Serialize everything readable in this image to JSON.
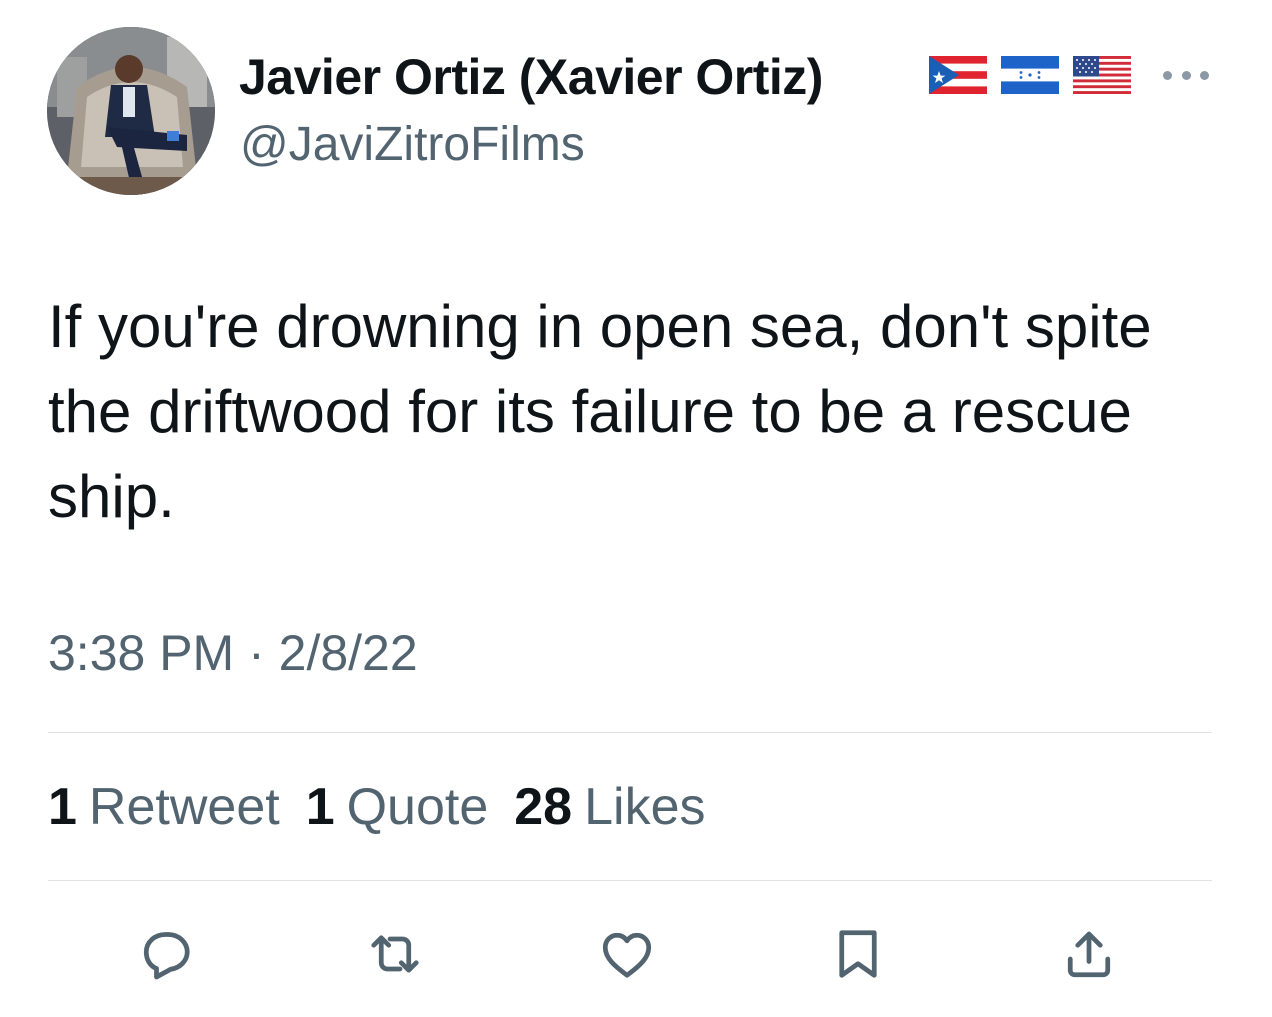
{
  "author": {
    "display_name": "Javier Ortiz (Xavier Ortiz)",
    "handle": "@JaviZitroFilms",
    "flags": [
      "puerto-rico-flag",
      "honduras-flag",
      "united-states-flag"
    ]
  },
  "tweet": {
    "text": "If you're drowning in open sea, don't spite the driftwood for its failure to be a rescue ship.",
    "timestamp": "3:38 PM · 2/8/22"
  },
  "stats": {
    "retweets_count": "1",
    "retweets_label": "Retweet",
    "quotes_count": "1",
    "quotes_label": "Quote",
    "likes_count": "28",
    "likes_label": "Likes"
  },
  "actions": [
    "reply-icon",
    "retweet-icon",
    "like-icon",
    "bookmark-icon",
    "share-icon"
  ],
  "colors": {
    "text_primary": "#0f1419",
    "text_secondary": "#536471",
    "divider": "#dfe3e7",
    "icon": "#536471"
  }
}
